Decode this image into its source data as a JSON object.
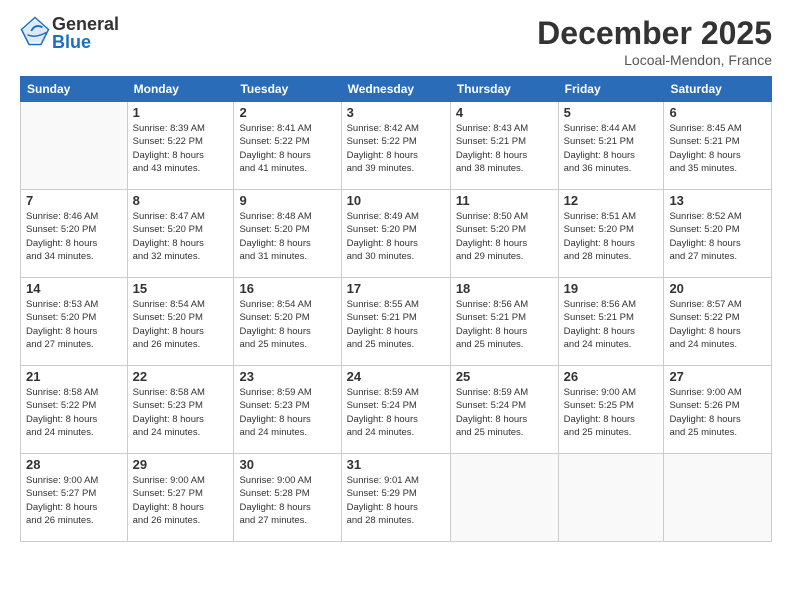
{
  "header": {
    "logo_general": "General",
    "logo_blue": "Blue",
    "month_title": "December 2025",
    "location": "Locoal-Mendon, France"
  },
  "days_of_week": [
    "Sunday",
    "Monday",
    "Tuesday",
    "Wednesday",
    "Thursday",
    "Friday",
    "Saturday"
  ],
  "weeks": [
    [
      {
        "day": "",
        "details": ""
      },
      {
        "day": "1",
        "details": "Sunrise: 8:39 AM\nSunset: 5:22 PM\nDaylight: 8 hours\nand 43 minutes."
      },
      {
        "day": "2",
        "details": "Sunrise: 8:41 AM\nSunset: 5:22 PM\nDaylight: 8 hours\nand 41 minutes."
      },
      {
        "day": "3",
        "details": "Sunrise: 8:42 AM\nSunset: 5:22 PM\nDaylight: 8 hours\nand 39 minutes."
      },
      {
        "day": "4",
        "details": "Sunrise: 8:43 AM\nSunset: 5:21 PM\nDaylight: 8 hours\nand 38 minutes."
      },
      {
        "day": "5",
        "details": "Sunrise: 8:44 AM\nSunset: 5:21 PM\nDaylight: 8 hours\nand 36 minutes."
      },
      {
        "day": "6",
        "details": "Sunrise: 8:45 AM\nSunset: 5:21 PM\nDaylight: 8 hours\nand 35 minutes."
      }
    ],
    [
      {
        "day": "7",
        "details": "Sunrise: 8:46 AM\nSunset: 5:20 PM\nDaylight: 8 hours\nand 34 minutes."
      },
      {
        "day": "8",
        "details": "Sunrise: 8:47 AM\nSunset: 5:20 PM\nDaylight: 8 hours\nand 32 minutes."
      },
      {
        "day": "9",
        "details": "Sunrise: 8:48 AM\nSunset: 5:20 PM\nDaylight: 8 hours\nand 31 minutes."
      },
      {
        "day": "10",
        "details": "Sunrise: 8:49 AM\nSunset: 5:20 PM\nDaylight: 8 hours\nand 30 minutes."
      },
      {
        "day": "11",
        "details": "Sunrise: 8:50 AM\nSunset: 5:20 PM\nDaylight: 8 hours\nand 29 minutes."
      },
      {
        "day": "12",
        "details": "Sunrise: 8:51 AM\nSunset: 5:20 PM\nDaylight: 8 hours\nand 28 minutes."
      },
      {
        "day": "13",
        "details": "Sunrise: 8:52 AM\nSunset: 5:20 PM\nDaylight: 8 hours\nand 27 minutes."
      }
    ],
    [
      {
        "day": "14",
        "details": "Sunrise: 8:53 AM\nSunset: 5:20 PM\nDaylight: 8 hours\nand 27 minutes."
      },
      {
        "day": "15",
        "details": "Sunrise: 8:54 AM\nSunset: 5:20 PM\nDaylight: 8 hours\nand 26 minutes."
      },
      {
        "day": "16",
        "details": "Sunrise: 8:54 AM\nSunset: 5:20 PM\nDaylight: 8 hours\nand 25 minutes."
      },
      {
        "day": "17",
        "details": "Sunrise: 8:55 AM\nSunset: 5:21 PM\nDaylight: 8 hours\nand 25 minutes."
      },
      {
        "day": "18",
        "details": "Sunrise: 8:56 AM\nSunset: 5:21 PM\nDaylight: 8 hours\nand 25 minutes."
      },
      {
        "day": "19",
        "details": "Sunrise: 8:56 AM\nSunset: 5:21 PM\nDaylight: 8 hours\nand 24 minutes."
      },
      {
        "day": "20",
        "details": "Sunrise: 8:57 AM\nSunset: 5:22 PM\nDaylight: 8 hours\nand 24 minutes."
      }
    ],
    [
      {
        "day": "21",
        "details": "Sunrise: 8:58 AM\nSunset: 5:22 PM\nDaylight: 8 hours\nand 24 minutes."
      },
      {
        "day": "22",
        "details": "Sunrise: 8:58 AM\nSunset: 5:23 PM\nDaylight: 8 hours\nand 24 minutes."
      },
      {
        "day": "23",
        "details": "Sunrise: 8:59 AM\nSunset: 5:23 PM\nDaylight: 8 hours\nand 24 minutes."
      },
      {
        "day": "24",
        "details": "Sunrise: 8:59 AM\nSunset: 5:24 PM\nDaylight: 8 hours\nand 24 minutes."
      },
      {
        "day": "25",
        "details": "Sunrise: 8:59 AM\nSunset: 5:24 PM\nDaylight: 8 hours\nand 25 minutes."
      },
      {
        "day": "26",
        "details": "Sunrise: 9:00 AM\nSunset: 5:25 PM\nDaylight: 8 hours\nand 25 minutes."
      },
      {
        "day": "27",
        "details": "Sunrise: 9:00 AM\nSunset: 5:26 PM\nDaylight: 8 hours\nand 25 minutes."
      }
    ],
    [
      {
        "day": "28",
        "details": "Sunrise: 9:00 AM\nSunset: 5:27 PM\nDaylight: 8 hours\nand 26 minutes."
      },
      {
        "day": "29",
        "details": "Sunrise: 9:00 AM\nSunset: 5:27 PM\nDaylight: 8 hours\nand 26 minutes."
      },
      {
        "day": "30",
        "details": "Sunrise: 9:00 AM\nSunset: 5:28 PM\nDaylight: 8 hours\nand 27 minutes."
      },
      {
        "day": "31",
        "details": "Sunrise: 9:01 AM\nSunset: 5:29 PM\nDaylight: 8 hours\nand 28 minutes."
      },
      {
        "day": "",
        "details": ""
      },
      {
        "day": "",
        "details": ""
      },
      {
        "day": "",
        "details": ""
      }
    ]
  ]
}
